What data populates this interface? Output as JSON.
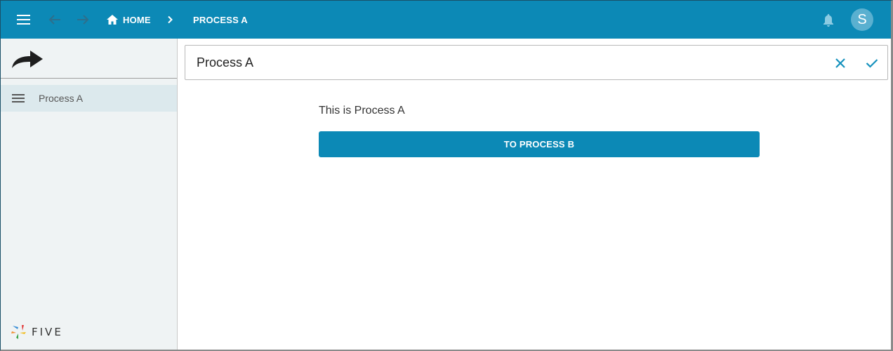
{
  "colors": {
    "appbar": "#0c89b6",
    "accent": "#0c89b6",
    "sidebar_bg": "#eff3f4",
    "sidebar_selected": "#dce9ed",
    "avatar_bg": "#5ab0d0"
  },
  "appbar": {
    "menu_icon": "hamburger-menu-icon",
    "back_icon": "arrow-back-icon",
    "forward_icon": "arrow-forward-icon",
    "breadcrumb": [
      {
        "label": "HOME",
        "icon": "home-icon"
      },
      {
        "label": "PROCESS A"
      }
    ],
    "separator_icon": "chevron-right-icon",
    "notification_icon": "bell-icon",
    "avatar_initial": "S"
  },
  "sidebar": {
    "header_icon": "share-arrow-icon",
    "items": [
      {
        "label": "Process A",
        "icon": "list-lines-icon",
        "selected": true
      }
    ],
    "footer_logo_text": "FIVE"
  },
  "main": {
    "title": "Process A",
    "cancel_icon": "close-icon",
    "confirm_icon": "check-icon",
    "description": "This is Process A",
    "action_button": "TO PROCESS B"
  }
}
